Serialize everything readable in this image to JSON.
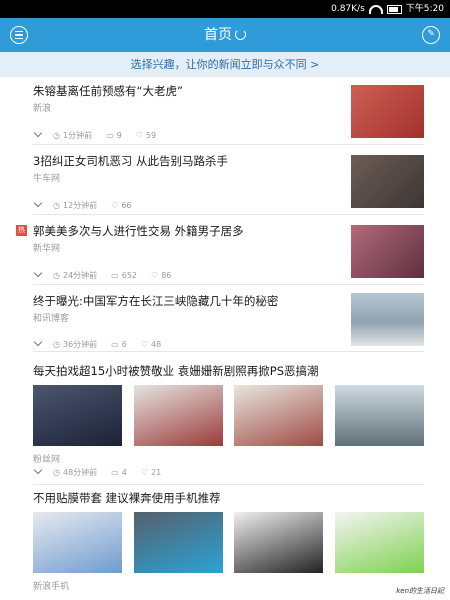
{
  "status": {
    "speed": "0.87K/s",
    "time": "下午5:20"
  },
  "header": {
    "title": "首页"
  },
  "interest_bar": {
    "text": "选择兴趣，让你的新闻立即与众不同 >"
  },
  "news": [
    {
      "title": "朱镕基离任前预感有“大老虎”",
      "source": "新浪",
      "time": "1分钟前",
      "comments": "9",
      "likes": "59",
      "hot": false,
      "thumb": "#b94b43"
    },
    {
      "title": "3招纠正女司机恶习 从此告别马路杀手",
      "source": "牛车网",
      "time": "12分钟前",
      "comments": "",
      "likes": "66",
      "hot": false,
      "thumb": "#5b5350"
    },
    {
      "title": "郭美美多次与人进行性交易 外籍男子居多",
      "source": "新华网",
      "time": "24分钟前",
      "comments": "652",
      "likes": "86",
      "hot": true,
      "hot_label": "热",
      "thumb": "#8a4b5a"
    },
    {
      "title": "终于曝光:中国军方在长江三峡隐藏几十年的秘密",
      "source": "和讯博客",
      "time": "36分钟前",
      "comments": "6",
      "likes": "48",
      "hot": false,
      "thumb": "#97a8b4"
    }
  ],
  "gallery_items": [
    {
      "title": "每天拍戏超15小时被赞敬业 袁姗姗新剧照再掀PS恶搞潮",
      "source": "粉丝网",
      "time": "48分钟前",
      "comments": "4",
      "likes": "21",
      "images": [
        "#2b3550",
        "#c9c9c6",
        "#c8c6c0",
        "#9fb3bf"
      ]
    },
    {
      "title": "不用贴膜带套 建议裸奔使用手机推荐",
      "source": "新浪手机",
      "time": "",
      "comments": "",
      "likes": "",
      "images": [
        "#cfd6dc",
        "#7a8692",
        "#e6e6e6",
        "#9dd07b"
      ]
    }
  ],
  "watermark": "ken的生活日記"
}
